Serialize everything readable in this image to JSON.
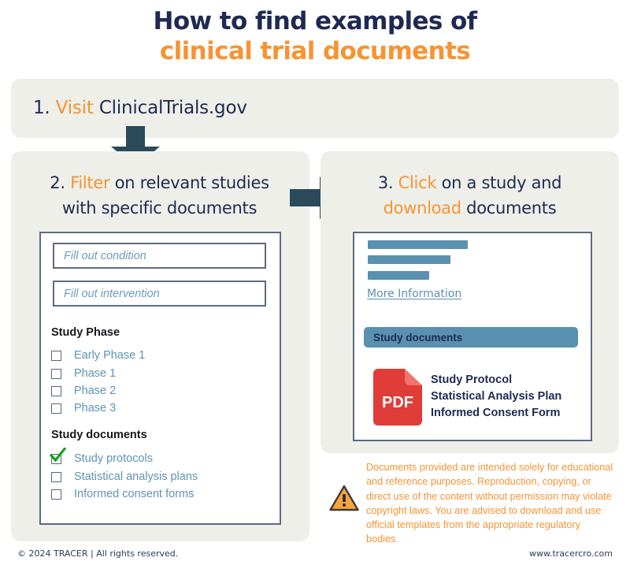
{
  "title": {
    "line1": "How to find examples of",
    "line2": "clinical trial documents"
  },
  "steps": {
    "step1": {
      "number": "1.",
      "action": "Visit",
      "rest": "ClinicalTrials.gov"
    },
    "step2": {
      "number": "2.",
      "action": "Filter",
      "rest_line1": "on relevant studies",
      "rest_line2": "with specific documents"
    },
    "step3": {
      "number": "3.",
      "action": "Click",
      "rest_line1": "on a study and",
      "action2": "download",
      "rest_line2": "documents"
    }
  },
  "filter_card": {
    "condition_placeholder": "Fill out condition",
    "intervention_placeholder": "Fill out intervention",
    "study_phase_title": "Study Phase",
    "phases": [
      {
        "label": "Early Phase 1",
        "checked": false
      },
      {
        "label": "Phase 1",
        "checked": false
      },
      {
        "label": "Phase 2",
        "checked": false
      },
      {
        "label": "Phase 3",
        "checked": false
      }
    ],
    "study_documents_title": "Study documents",
    "documents": [
      {
        "label": "Study protocols",
        "checked": true
      },
      {
        "label": "Statistical analysis plans",
        "checked": false
      },
      {
        "label": "Informed consent forms",
        "checked": false
      }
    ]
  },
  "study_card": {
    "more_information": "More Information",
    "documents_pill": "Study documents",
    "pdf_badge": "PDF",
    "document_list": [
      "Study Protocol",
      "Statistical Analysis Plan",
      "Informed Consent Form"
    ]
  },
  "disclaimer": {
    "text": "Documents provided are intended solely for educational and reference purposes. Reproduction, copying, or direct use of the content without permission may violate copyright laws. You are advised to download and use official templates from the appropriate regulatory bodies."
  },
  "footer": {
    "left": "© 2024 TRACER | All rights reserved.",
    "right": "www.tracercro.com"
  },
  "colors": {
    "navy": "#1f2a52",
    "orange": "#f79334",
    "panel_bg": "#eeefe9",
    "blue": "#5a90b0",
    "arrow": "#2b4a59",
    "pdf_red": "#e03c38",
    "check_green": "#16a020"
  }
}
